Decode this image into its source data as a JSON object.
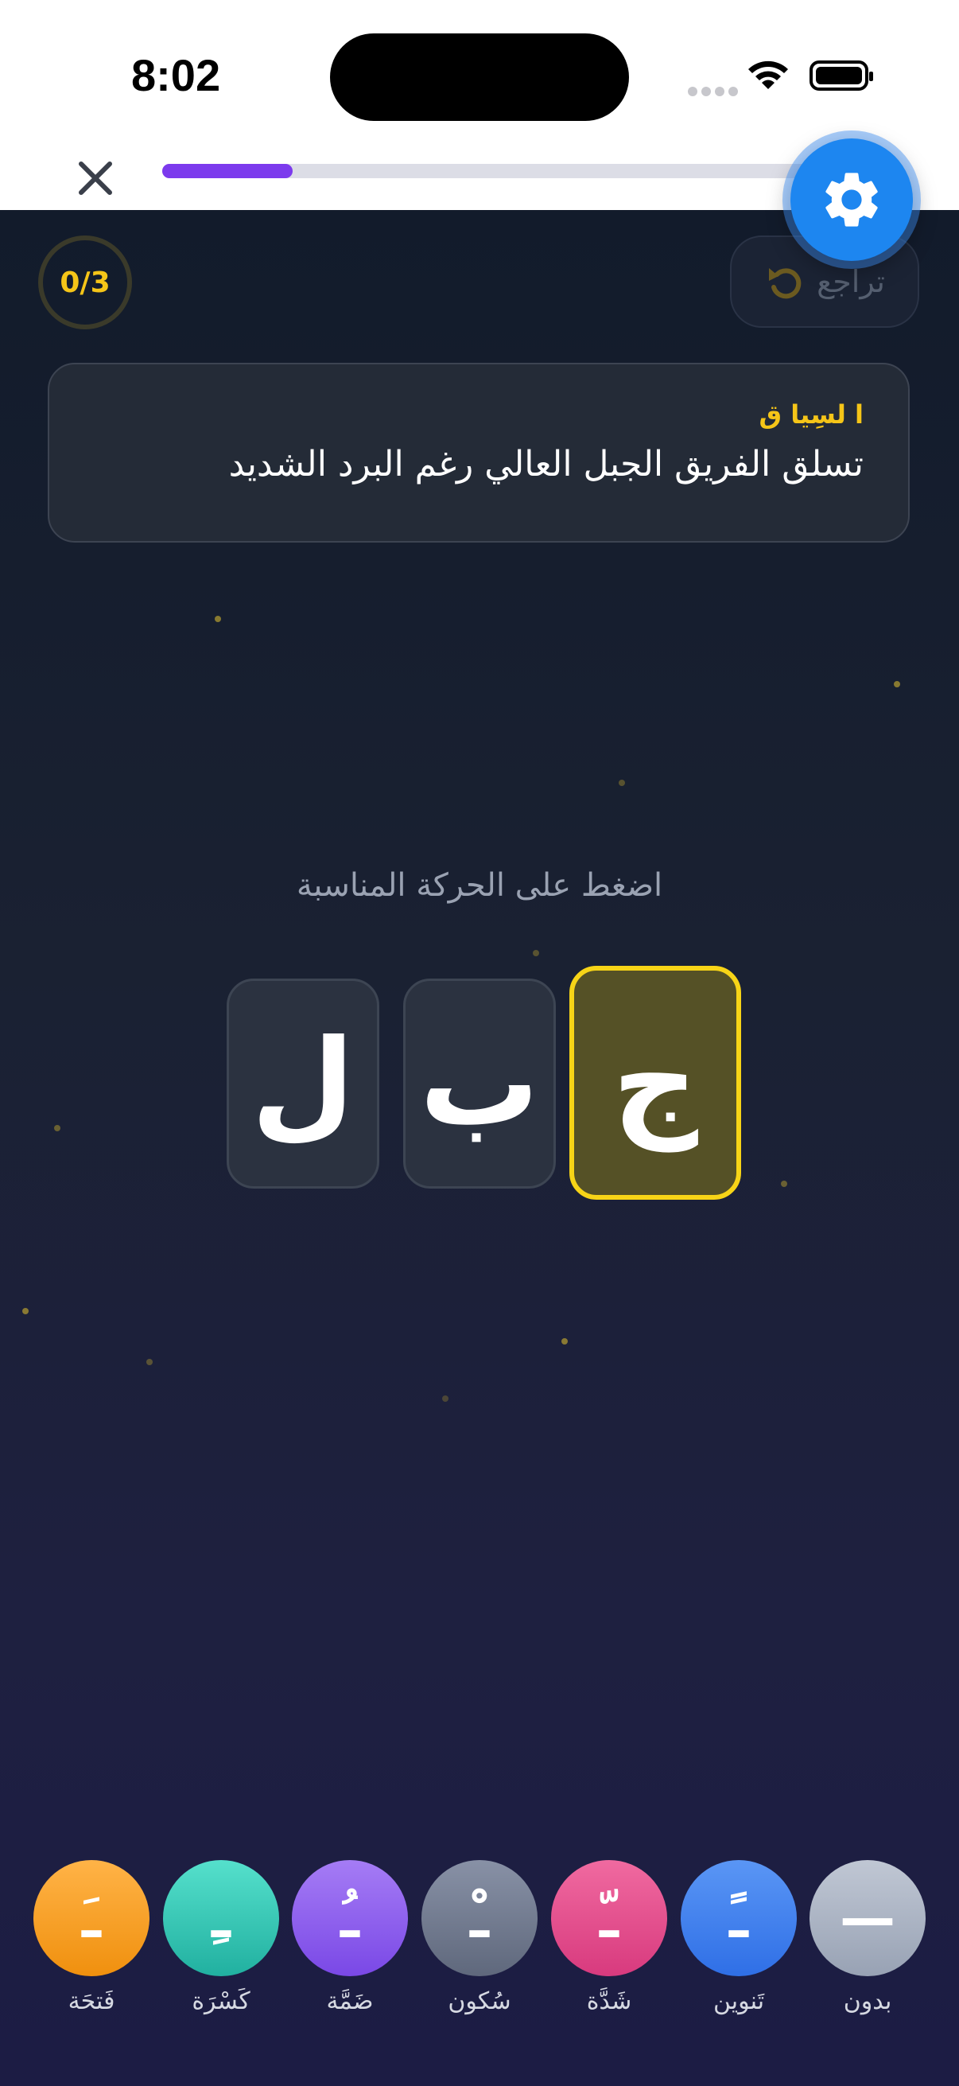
{
  "status_bar": {
    "time": "8:02"
  },
  "progress": {
    "fraction": 0.2
  },
  "score": {
    "text": "0/3"
  },
  "undo": {
    "label": "تراجع"
  },
  "context": {
    "title": "ا لسِيا ق",
    "text": "تسلق الفريق الجبل العالي رغم البرد الشديد"
  },
  "instruction": "اضغط على الحركة المناسبة",
  "letters": [
    {
      "char": "ج",
      "state": "active"
    },
    {
      "char": "ب",
      "state": "default"
    },
    {
      "char": "ل",
      "state": "default"
    }
  ],
  "harakat": [
    {
      "mark": "ـَ",
      "label": "فَتحَة",
      "color": "#f39c12"
    },
    {
      "mark": "ـِ",
      "label": "كَسْرَة",
      "color": "#2ec4b6"
    },
    {
      "mark": "ـُ",
      "label": "ضَمَّة",
      "color": "#8e5cf0"
    },
    {
      "mark": "ـْ",
      "label": "سُكون",
      "color": "#6f7a90"
    },
    {
      "mark": "ـّ",
      "label": "شَدَّة",
      "color": "#e84b8a"
    },
    {
      "mark": "ـً",
      "label": "تَنوين",
      "color": "#3a7ff0"
    },
    {
      "mark": "—",
      "label": "بدون",
      "color": "#a9b2c2"
    }
  ],
  "colors": {
    "accent_purple": "#7c3aed",
    "score_yellow": "#f5c518",
    "settings_blue": "#1d86f0"
  }
}
